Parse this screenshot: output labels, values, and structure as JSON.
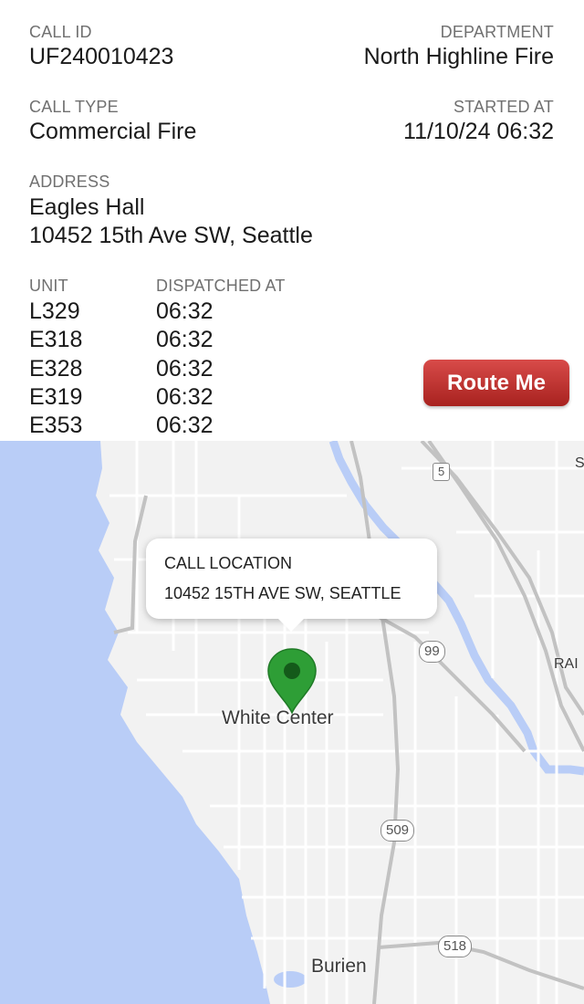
{
  "call": {
    "id_label": "CALL ID",
    "id_value": "UF240010423",
    "dept_label": "DEPARTMENT",
    "dept_value": "North Highline Fire",
    "type_label": "CALL TYPE",
    "type_value": "Commercial Fire",
    "started_label": "STARTED AT",
    "started_value": "11/10/24 06:32",
    "address_label": "ADDRESS",
    "address_line1": "Eagles Hall",
    "address_line2": "10452 15th Ave SW, Seattle"
  },
  "units": {
    "unit_header": "UNIT",
    "dispatched_header": "DISPATCHED AT",
    "rows": [
      {
        "unit": "L329",
        "time": "06:32"
      },
      {
        "unit": "E318",
        "time": "06:32"
      },
      {
        "unit": "E328",
        "time": "06:32"
      },
      {
        "unit": "E319",
        "time": "06:32"
      },
      {
        "unit": "E353",
        "time": "06:32"
      }
    ]
  },
  "route_button": "Route Me",
  "map": {
    "popup_title": "CALL LOCATION",
    "popup_address": "10452 15TH AVE SW, SEATTLE",
    "places": {
      "white_center": "White Center",
      "burien": "Burien",
      "edge_s": "S",
      "edge_rai": "RAI"
    },
    "shields": {
      "i5": "5",
      "r99": "99",
      "r509": "509",
      "r518": "518"
    },
    "colors": {
      "water": "#b9cdf7",
      "land": "#f2f2f2",
      "pin": "#2e9e36",
      "road": "#ffffff",
      "highway": "#c2c2c2"
    },
    "pin_icon": "map-marker-icon"
  }
}
